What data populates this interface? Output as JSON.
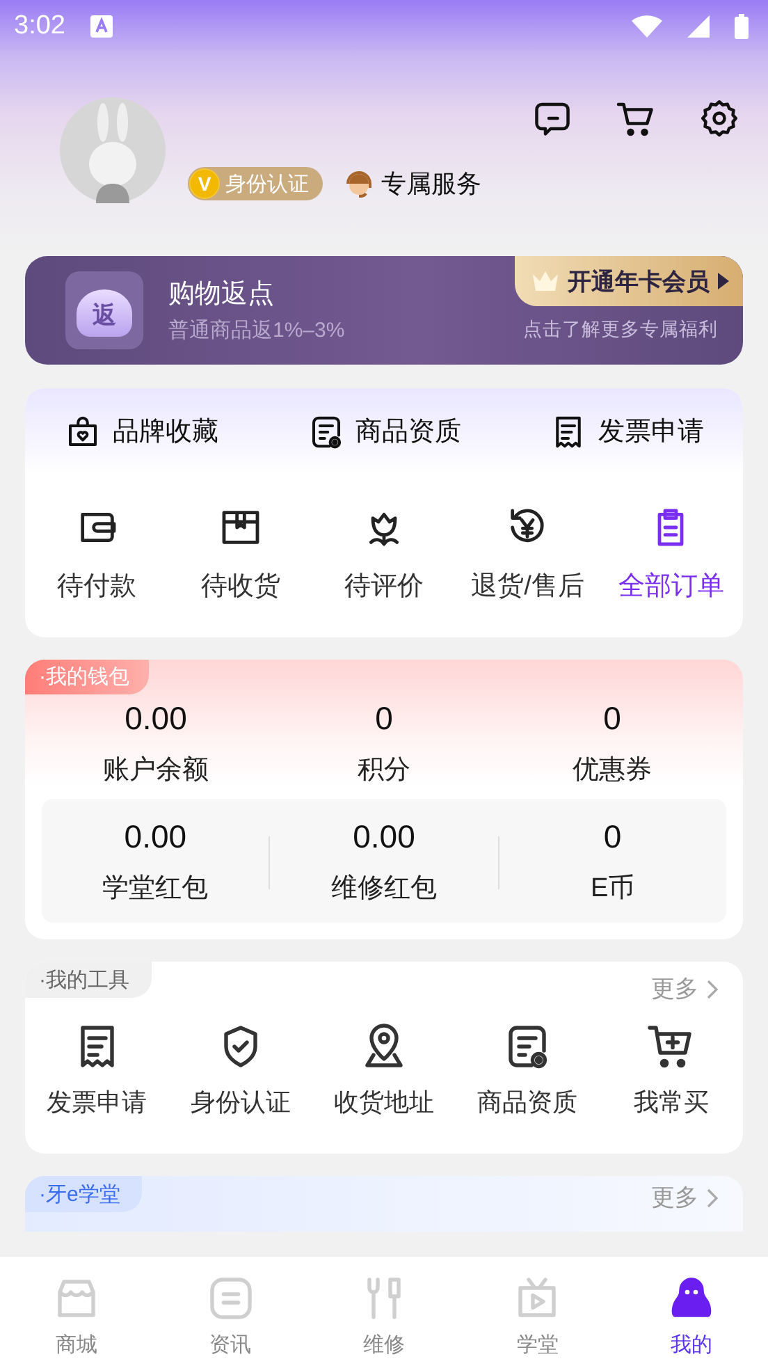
{
  "status_bar": {
    "time": "3:02"
  },
  "profile": {
    "badges": [
      {
        "kind": "verify",
        "coin_text": "V",
        "label": "身份认证"
      },
      {
        "kind": "service",
        "label": "专属服务"
      }
    ]
  },
  "rebate_banner": {
    "icon_text": "返",
    "title": "购物返点",
    "subtitle": "普通商品返1%–3%",
    "member_button": "开通年卡会员",
    "member_hint": "点击了解更多专属福利"
  },
  "shortcuts": [
    "品牌收藏",
    "商品资质",
    "发票申请"
  ],
  "orders": [
    {
      "label": "待付款",
      "selected": false
    },
    {
      "label": "待收货",
      "selected": false
    },
    {
      "label": "待评价",
      "selected": false
    },
    {
      "label": "退货/售后",
      "selected": false
    },
    {
      "label": "全部订单",
      "selected": true
    }
  ],
  "wallet": {
    "title": "·我的钱包",
    "stats": [
      {
        "value": "0.00",
        "label": "账户余额"
      },
      {
        "value": "0",
        "label": "积分"
      },
      {
        "value": "0",
        "label": "优惠券"
      }
    ],
    "sub_stats": [
      {
        "value": "0.00",
        "label": "学堂红包"
      },
      {
        "value": "0.00",
        "label": "维修红包"
      },
      {
        "value": "0",
        "label": "E币"
      }
    ]
  },
  "tools": {
    "title": "·我的工具",
    "more": "更多",
    "items": [
      "发票申请",
      "身份认证",
      "收货地址",
      "商品资质",
      "我常买"
    ]
  },
  "school": {
    "title": "·牙e学堂",
    "more": "更多"
  },
  "tab_bar": [
    {
      "label": "商城",
      "selected": false
    },
    {
      "label": "资讯",
      "selected": false
    },
    {
      "label": "维修",
      "selected": false
    },
    {
      "label": "学堂",
      "selected": false
    },
    {
      "label": "我的",
      "selected": true
    }
  ]
}
